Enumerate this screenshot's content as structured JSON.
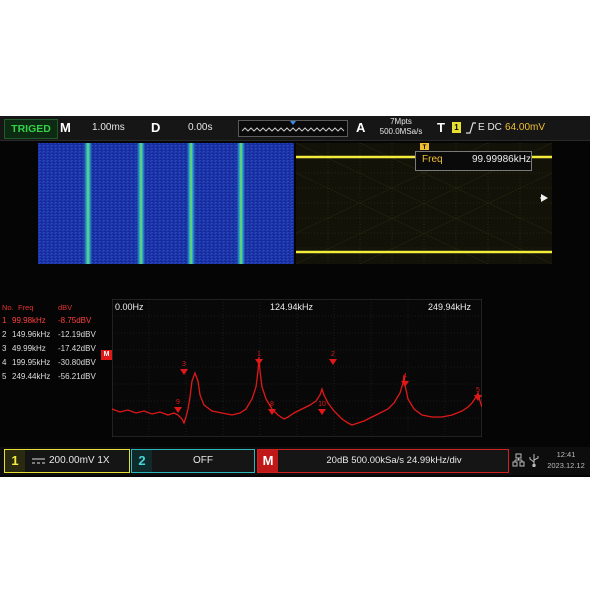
{
  "top_bar": {
    "trigger_status": "TRIGED",
    "timebase_key": "M",
    "timebase_value": "1.00ms",
    "delay_key": "D",
    "delay_value": "0.00s",
    "acquire_key": "A",
    "memory_depth": "7Mpts",
    "sample_rate": "500.0MSa/s",
    "trigger_key": "T",
    "trigger_source": "1",
    "trigger_edge_icon": "rising-edge-icon",
    "trigger_coupling": "E DC",
    "trigger_level": "64.00mV"
  },
  "measurement": {
    "label": "Freq",
    "value": "99.99986kHz"
  },
  "time_panel": {
    "trigger_marker": "T"
  },
  "peak_table": {
    "headers": {
      "no": "No.",
      "freq": "Freq",
      "amp": "dBV"
    },
    "rows": [
      {
        "no": "1",
        "freq": "99.98kHz",
        "amp": "-8.75dBV"
      },
      {
        "no": "2",
        "freq": "149.96kHz",
        "amp": "-12.19dBV"
      },
      {
        "no": "3",
        "freq": "49.99kHz",
        "amp": "-17.42dBV"
      },
      {
        "no": "4",
        "freq": "199.95kHz",
        "amp": "-30.80dBV"
      },
      {
        "no": "5",
        "freq": "249.44kHz",
        "amp": "-56.21dBV"
      }
    ]
  },
  "spectrum": {
    "axis_left": "0.00Hz",
    "axis_center": "124.94kHz",
    "axis_right": "249.94kHz",
    "math_marker": "M"
  },
  "bottom_bar": {
    "ch1_number": "1",
    "ch1_text": "200.00mV 1X",
    "ch2_number": "2",
    "ch2_text": "OFF",
    "math_number": "M",
    "math_text": "20dB 500.00kSa/s 24.99kHz/div",
    "clock_time": "12:41",
    "clock_date": "2023.12.12"
  },
  "colors": {
    "ch1": "#e8e030",
    "ch2": "#2ab8b8",
    "math": "#d02020",
    "trigger_ok": "#33d14a",
    "spectrum_trace": "#e01818"
  },
  "chart_data": {
    "type": "line",
    "title": "",
    "xlabel": "",
    "ylabel": "",
    "x_tick_labels": [
      "0.00Hz",
      "124.94kHz",
      "249.94kHz"
    ],
    "series": [
      {
        "name": "",
        "x": [
          0.0,
          1.0,
          2.0
        ],
        "y": [
          0,
          0,
          0
        ]
      }
    ],
    "peaks_kHz": [
      99.98,
      149.96,
      49.99,
      199.95,
      249.44
    ],
    "peaks_dBV": [
      -8.75,
      -12.19,
      -17.42,
      -30.8,
      -56.21
    ]
  }
}
